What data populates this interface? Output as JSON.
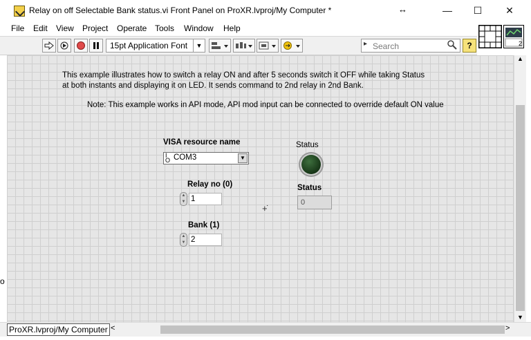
{
  "window": {
    "title": "Relay on off Selectable Bank status.vi Front Panel on ProXR.lvproj/My Computer *",
    "controls": {
      "minimize": "—",
      "maximize": "☐",
      "close": "✕",
      "resize": "↔"
    }
  },
  "menu": [
    "File",
    "Edit",
    "View",
    "Project",
    "Operate",
    "Tools",
    "Window",
    "Help"
  ],
  "toolbar": {
    "font": "15pt Application Font",
    "search_placeholder": "Search",
    "help_label": "?"
  },
  "connector": {
    "pane_label": "2"
  },
  "panel": {
    "description_line1": "This example illustrates how to switch a relay ON and after 5 seconds switch it OFF while taking Status",
    "description_line2": "at both instants and displaying it on LED. It sends command to 2nd relay in 2nd Bank.",
    "note": "Note: This example works in API mode, API mod input can be connected to override default ON value",
    "visa": {
      "label": "VISA resource name",
      "value": "COM3"
    },
    "relay_no": {
      "label": "Relay no (0)",
      "value": "1"
    },
    "bank": {
      "label": "Bank (1)",
      "value": "2"
    },
    "status_led": {
      "label": "Status",
      "state": "off"
    },
    "status_indicator": {
      "label": "Status",
      "value": "0"
    }
  },
  "statusbar": {
    "project_path": "ProXR.lvproj/My Computer"
  },
  "stray_left_text": "o"
}
